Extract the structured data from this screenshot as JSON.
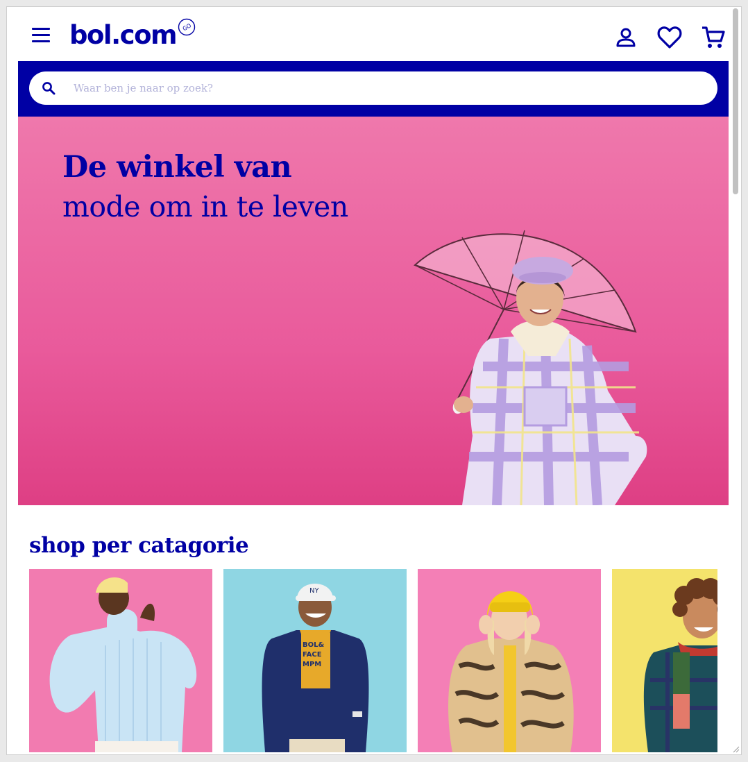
{
  "header": {
    "logo_text": "bol.com",
    "menu_icon": "hamburger-menu-icon",
    "icons": [
      "account-icon",
      "heart-icon",
      "cart-icon"
    ],
    "brand_color": "#0000a4"
  },
  "search": {
    "placeholder": "Waar ben je naar op zoek?",
    "value": "",
    "icon": "search-icon"
  },
  "hero": {
    "title_bold": "De winkel van",
    "title_regular": "mode om in te leven",
    "background_color": "#ef78ac"
  },
  "categories": {
    "heading": "shop per catagorie",
    "items": [
      {
        "image": "woman-in-light-blue-sweater",
        "background": "#f27bb0"
      },
      {
        "image": "man-in-navy-blazer-and-cap",
        "background": "#8fd6e3"
      },
      {
        "image": "girl-in-zebra-coat-yellow-beanie",
        "background": "#f47fb6"
      },
      {
        "image": "boy-with-scarf",
        "background": "#f4e36c"
      }
    ]
  }
}
